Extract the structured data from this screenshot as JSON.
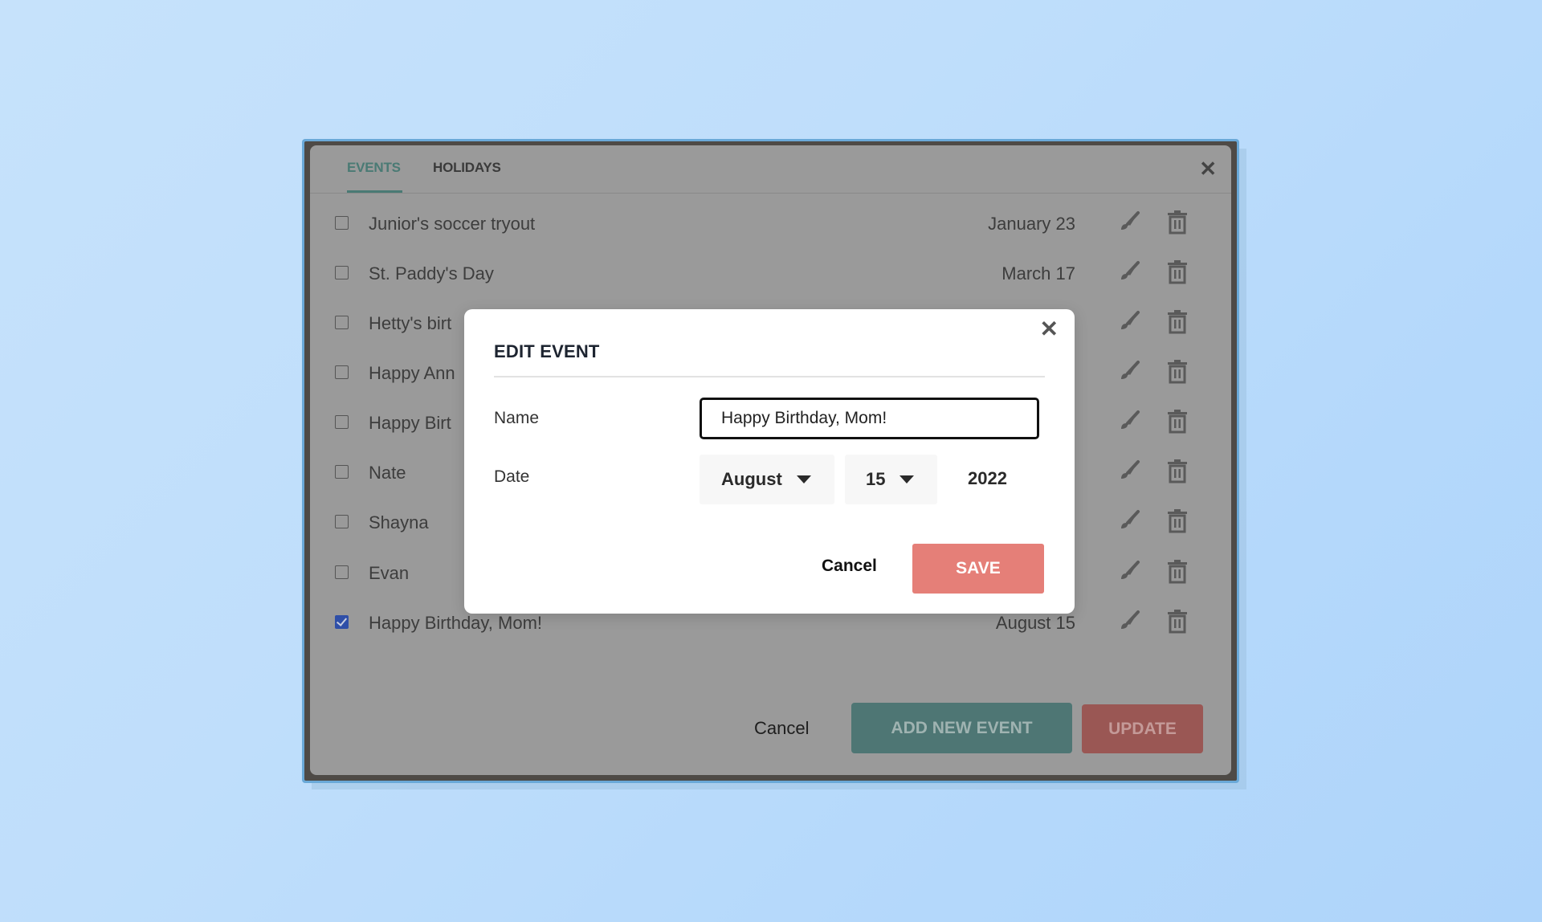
{
  "tabs": [
    {
      "label": "EVENTS",
      "active": true
    },
    {
      "label": "HOLIDAYS",
      "active": false
    }
  ],
  "close_icon": "close-icon",
  "events": [
    {
      "name": "Junior's soccer tryout",
      "date": "January 23",
      "checked": false
    },
    {
      "name": "St. Paddy's Day",
      "date": "March 17",
      "checked": false
    },
    {
      "name": "Hetty's birt",
      "date": "",
      "checked": false
    },
    {
      "name": "Happy Ann",
      "date": "",
      "checked": false
    },
    {
      "name": "Happy Birt",
      "date": "",
      "checked": false
    },
    {
      "name": "Nate",
      "date": "",
      "checked": false
    },
    {
      "name": "Shayna",
      "date": "",
      "checked": false
    },
    {
      "name": "Evan",
      "date": "",
      "checked": false
    },
    {
      "name": "Happy Birthday, Mom!",
      "date": "August 15",
      "checked": true
    }
  ],
  "row_icons": {
    "edit": "paintbrush-icon",
    "delete": "trash-icon"
  },
  "footer": {
    "cancel_label": "Cancel",
    "add_label": "ADD NEW EVENT",
    "update_label": "UPDATE"
  },
  "modal": {
    "title": "EDIT EVENT",
    "name_label": "Name",
    "name_value": "Happy Birthday, Mom!",
    "date_label": "Date",
    "month": "August",
    "day": "15",
    "year": "2022",
    "cancel_label": "Cancel",
    "save_label": "SAVE"
  },
  "colors": {
    "accent_teal": "#4a7a74",
    "save_red": "#e57f78",
    "overlay_gray": "#9a9a9a"
  }
}
